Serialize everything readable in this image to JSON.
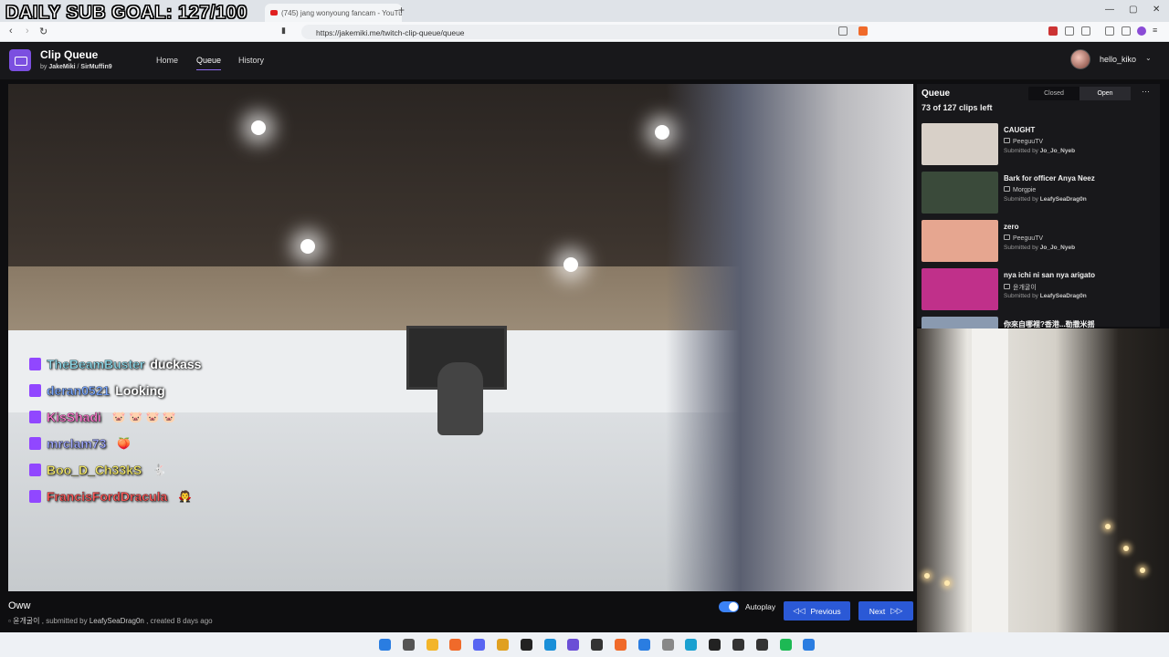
{
  "overlay": {
    "goal_text": "DAILY SUB GOAL: 127/100"
  },
  "browser": {
    "tab_title": "(745) jang wonyoung fancam - YouTube",
    "url": "https://jakemiki.me/twitch-clip-queue/queue"
  },
  "app": {
    "title": "Clip Queue",
    "by_prefix": "by",
    "author1": "JakeMiki",
    "separator": "/",
    "author2": "SirMuffin9",
    "nav": {
      "home": "Home",
      "queue": "Queue",
      "history": "History"
    },
    "username": "hello_kiko"
  },
  "chat": [
    {
      "user": "TheBeamBuster",
      "color": "#8ed8e8",
      "message": "duckass",
      "emote": ""
    },
    {
      "user": "deran0521",
      "color": "#7aa7ff",
      "message": "Looking",
      "emote": ""
    },
    {
      "user": "KisShadi",
      "color": "#ff7ad0",
      "message": "",
      "emote": "🐷 🐷 🐷 🐷"
    },
    {
      "user": "mrclam73",
      "color": "#9fa8ff",
      "message": "",
      "emote": "🍑"
    },
    {
      "user": "Boo_D_Ch33kS",
      "color": "#f4e96a",
      "message": "",
      "emote": "🐇"
    },
    {
      "user": "FrancisFordDracula",
      "color": "#ff5a5a",
      "message": "",
      "emote": "🧛"
    }
  ],
  "current_clip": {
    "title": "Oww",
    "channel": "윤개굴이",
    "submitted_by_prefix": ", submitted by",
    "submitter": "LeafySeaDrag0n",
    "created": ", created 8 days ago"
  },
  "controls": {
    "autoplay_label": "Autoplay",
    "autoplay_on": true,
    "previous": "Previous",
    "next": "Next"
  },
  "queue": {
    "title": "Queue",
    "count": "73 of 127 clips left",
    "closed_label": "Closed",
    "open_label": "Open",
    "menu": "⋯",
    "items": [
      {
        "title": "CAUGHT",
        "channel": "PeeguuTV",
        "submitted_prefix": "Submitted by",
        "submitter": "Jo_Jo_Nyeb",
        "thumb": "#d8d0c8"
      },
      {
        "title": "Bark for officer Anya Neez",
        "channel": "Morgpie",
        "submitted_prefix": "Submitted by",
        "submitter": "LeafySeaDrag0n",
        "thumb": "#3a4a3a"
      },
      {
        "title": "zero",
        "channel": "PeeguuTV",
        "submitted_prefix": "Submitted by",
        "submitter": "Jo_Jo_Nyeb",
        "thumb": "#e6a690"
      },
      {
        "title": "nya ichi ni san nya arigato",
        "channel": "윤개굴이",
        "submitted_prefix": "Submitted by",
        "submitter": "LeafySeaDrag0n",
        "thumb": "#c0308a"
      },
      {
        "title": "你來自哪裡?香港...勒撒米揺",
        "channel": "",
        "submitted_prefix": "",
        "submitter": "",
        "thumb": "#8a9ab0"
      }
    ]
  },
  "taskbar_icons": [
    "windows-start",
    "task-view",
    "file-explorer",
    "brave",
    "discord",
    "chrome",
    "obs",
    "edge",
    "streamer-app",
    "epic",
    "brave-2",
    "notepad",
    "app-1",
    "app-2",
    "xbox",
    "app-3",
    "terminal",
    "spotify",
    "notes"
  ]
}
